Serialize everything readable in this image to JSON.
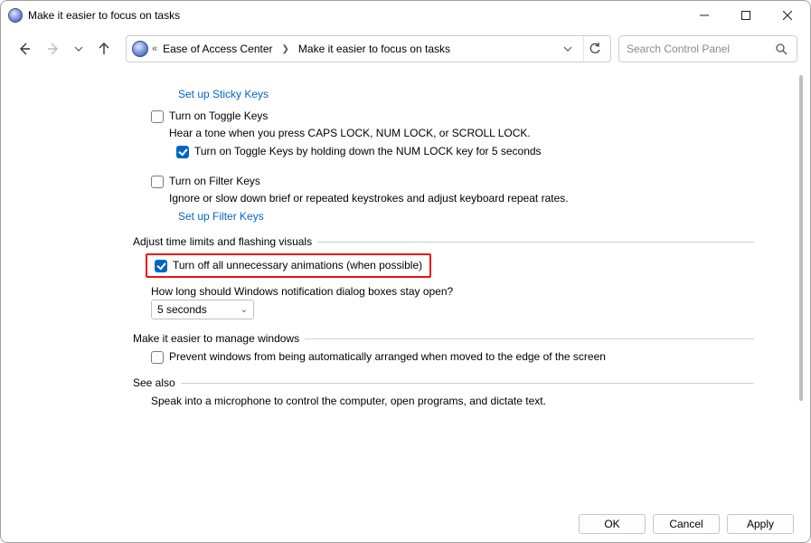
{
  "window": {
    "title": "Make it easier to focus on tasks"
  },
  "breadcrumb": {
    "level1": "Ease of Access Center",
    "level2": "Make it easier to focus on tasks"
  },
  "search": {
    "placeholder": "Search Control Panel"
  },
  "links": {
    "sticky_keys": "Set up Sticky Keys",
    "filter_keys": "Set up Filter Keys"
  },
  "toggle_keys": {
    "label": "Turn on Toggle Keys",
    "desc": "Hear a tone when you press CAPS LOCK, NUM LOCK, or SCROLL LOCK.",
    "sub_label": "Turn on Toggle Keys by holding down the NUM LOCK key for 5 seconds",
    "checked": false,
    "sub_checked": true
  },
  "filter_keys": {
    "label": "Turn on Filter Keys",
    "desc": "Ignore or slow down brief or repeated keystrokes and adjust keyboard repeat rates.",
    "checked": false
  },
  "group_time": {
    "title": "Adjust time limits and flashing visuals",
    "animations_label": "Turn off all unnecessary animations (when possible)",
    "animations_checked": true,
    "duration_label": "How long should Windows notification dialog boxes stay open?",
    "duration_value": "5 seconds"
  },
  "group_windows": {
    "title": "Make it easier to manage windows",
    "prevent_arrange_label": "Prevent windows from being automatically arranged when moved to the edge of the screen",
    "prevent_arrange_checked": false
  },
  "group_seealso": {
    "title": "See also",
    "speech_desc": "Speak into a microphone to control the computer, open programs, and dictate text."
  },
  "buttons": {
    "ok": "OK",
    "cancel": "Cancel",
    "apply": "Apply"
  }
}
